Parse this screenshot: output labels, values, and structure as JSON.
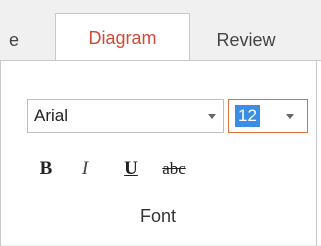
{
  "tabs": {
    "partial_label": "e",
    "active_label": "Diagram",
    "review_label": "Review"
  },
  "font_group": {
    "font_name": "Arial",
    "font_size": "12",
    "bold_label": "B",
    "italic_label": "I",
    "underline_label": "U",
    "strikethrough_label": "abc",
    "group_label": "Font"
  },
  "colors": {
    "active_tab_text": "#d24a35",
    "size_focus_border": "#e0713a",
    "selection_highlight": "#3a8ee6"
  }
}
